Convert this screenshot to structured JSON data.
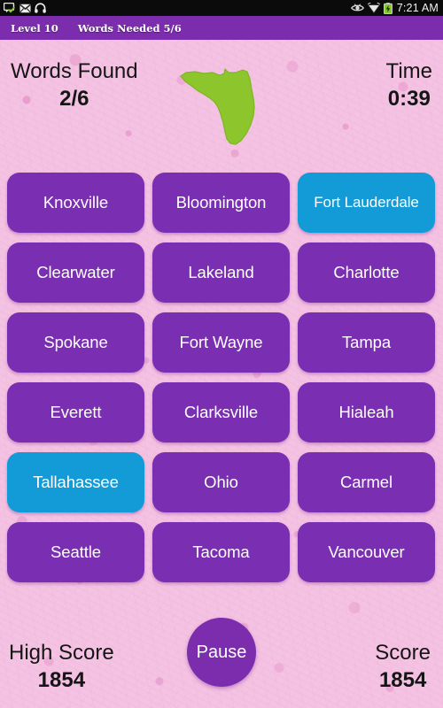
{
  "statusbar": {
    "icons_left": [
      "sms-message-icon",
      "gmail-envelope-icon",
      "headphones-icon"
    ],
    "icons_right": [
      "eye-icon",
      "wifi-icon",
      "battery-charging-icon"
    ],
    "time": "7:21 AM"
  },
  "levelbar": {
    "level": "Level 10",
    "words_needed": "Words Needed 5/6",
    "background_color": "#7b2dae"
  },
  "header": {
    "words_found_label": "Words Found",
    "words_found_value": "2/6",
    "time_label": "Time",
    "time_value": "0:39",
    "map_icon": "florida-state-map-icon",
    "map_color": "#8cc62c"
  },
  "grid": {
    "tile_color": "#7a2eb2",
    "found_color": "#129bd6",
    "tiles": [
      {
        "label": "Knoxville",
        "found": false
      },
      {
        "label": "Bloomington",
        "found": false
      },
      {
        "label": "Fort Lauderdale",
        "found": true
      },
      {
        "label": "Clearwater",
        "found": false
      },
      {
        "label": "Lakeland",
        "found": false
      },
      {
        "label": "Charlotte",
        "found": false
      },
      {
        "label": "Spokane",
        "found": false
      },
      {
        "label": "Fort Wayne",
        "found": false
      },
      {
        "label": "Tampa",
        "found": false
      },
      {
        "label": "Everett",
        "found": false
      },
      {
        "label": "Clarksville",
        "found": false
      },
      {
        "label": "Hialeah",
        "found": false
      },
      {
        "label": "Tallahassee",
        "found": true
      },
      {
        "label": "Ohio",
        "found": false
      },
      {
        "label": "Carmel",
        "found": false
      },
      {
        "label": "Seattle",
        "found": false
      },
      {
        "label": "Tacoma",
        "found": false
      },
      {
        "label": "Vancouver",
        "found": false
      }
    ]
  },
  "footer": {
    "high_score_label": "High Score",
    "high_score_value": "1854",
    "score_label": "Score",
    "score_value": "1854",
    "pause_label": "Pause"
  },
  "background": {
    "base_color": "#f4c2e2",
    "speckle_color": "#dc80be"
  }
}
